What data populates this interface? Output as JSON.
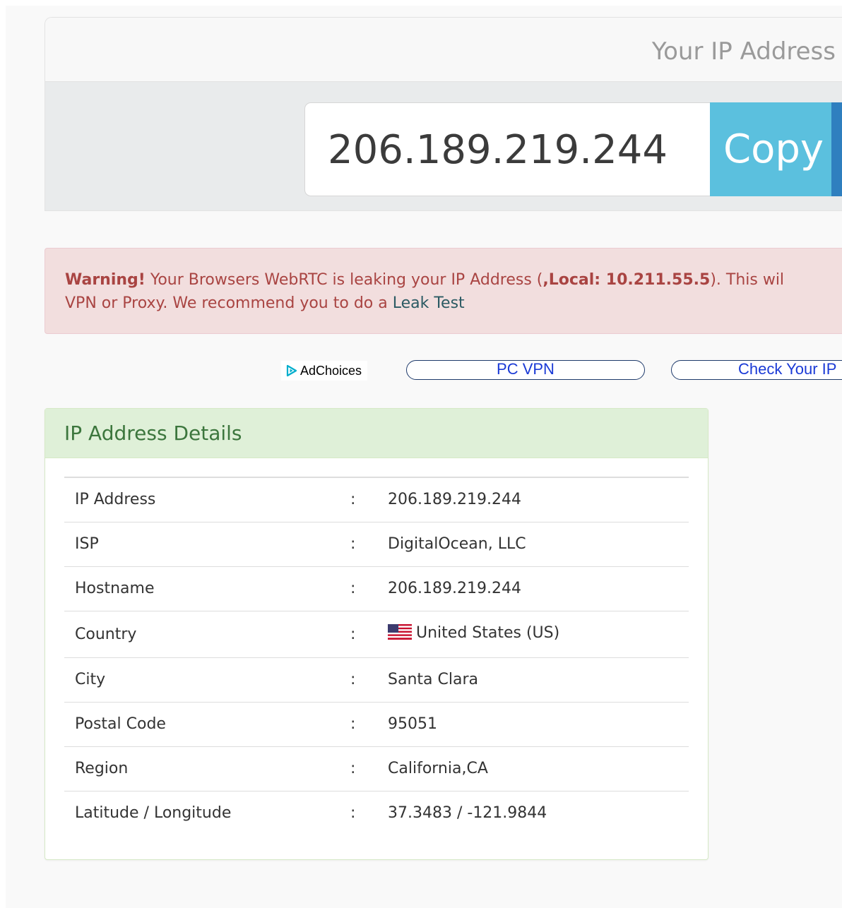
{
  "ip_card": {
    "title": "Your IP Address",
    "ip_value": "206.189.219.244",
    "copy_label": "Copy"
  },
  "warning": {
    "prefix": "Warning!",
    "text1": " Your Browsers WebRTC is leaking your IP Address (",
    "local": ",Local: 10.211.55.5",
    "text2": "). This wil",
    "text3": "VPN or Proxy. We recommend you to do a ",
    "link": "Leak Test"
  },
  "ads": {
    "adchoices_label": "AdChoices",
    "pill1": "PC VPN",
    "pill2": "Check Your IP"
  },
  "details": {
    "title": "IP Address Details",
    "separator": ":",
    "rows": [
      {
        "label": "IP Address",
        "value": "206.189.219.244"
      },
      {
        "label": "ISP",
        "value": "DigitalOcean, LLC"
      },
      {
        "label": "Hostname",
        "value": "206.189.219.244"
      },
      {
        "label": "Country",
        "value": "United States (US)",
        "icon": "us-flag-icon"
      },
      {
        "label": "City",
        "value": "Santa Clara"
      },
      {
        "label": "Postal Code",
        "value": "95051"
      },
      {
        "label": "Region",
        "value": "California,CA"
      },
      {
        "label": "Latitude / Longitude",
        "value": "37.3483 / -121.9844"
      }
    ]
  },
  "colors": {
    "copy_button": "#5bc0de",
    "warning_bg": "#f2dede",
    "warning_text": "#a94442",
    "details_header_bg": "#dff0d8",
    "details_header_text": "#3c763d"
  }
}
